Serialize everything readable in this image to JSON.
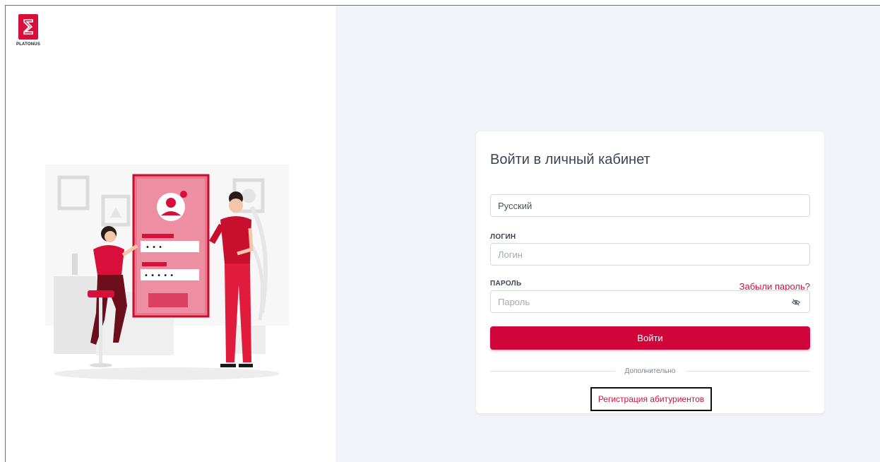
{
  "brand": {
    "name": "PLATONUS",
    "accent": "#d70f3a"
  },
  "login": {
    "title": "Войти в личный кабинет",
    "language_value": "Русский",
    "login_label": "ЛОГИН",
    "login_placeholder": "Логин",
    "password_label": "ПАРОЛЬ",
    "password_placeholder": "Пароль",
    "forgot_label": "Забыли пароль?",
    "submit_label": "Войти",
    "divider_label": "Дополнительно",
    "register_label": "Регистрация абитуриентов",
    "password_toggle_icon": "eye-off-icon"
  },
  "illustration": {
    "password_mask_1": "• • •",
    "password_mask_2": "• • • • •"
  }
}
